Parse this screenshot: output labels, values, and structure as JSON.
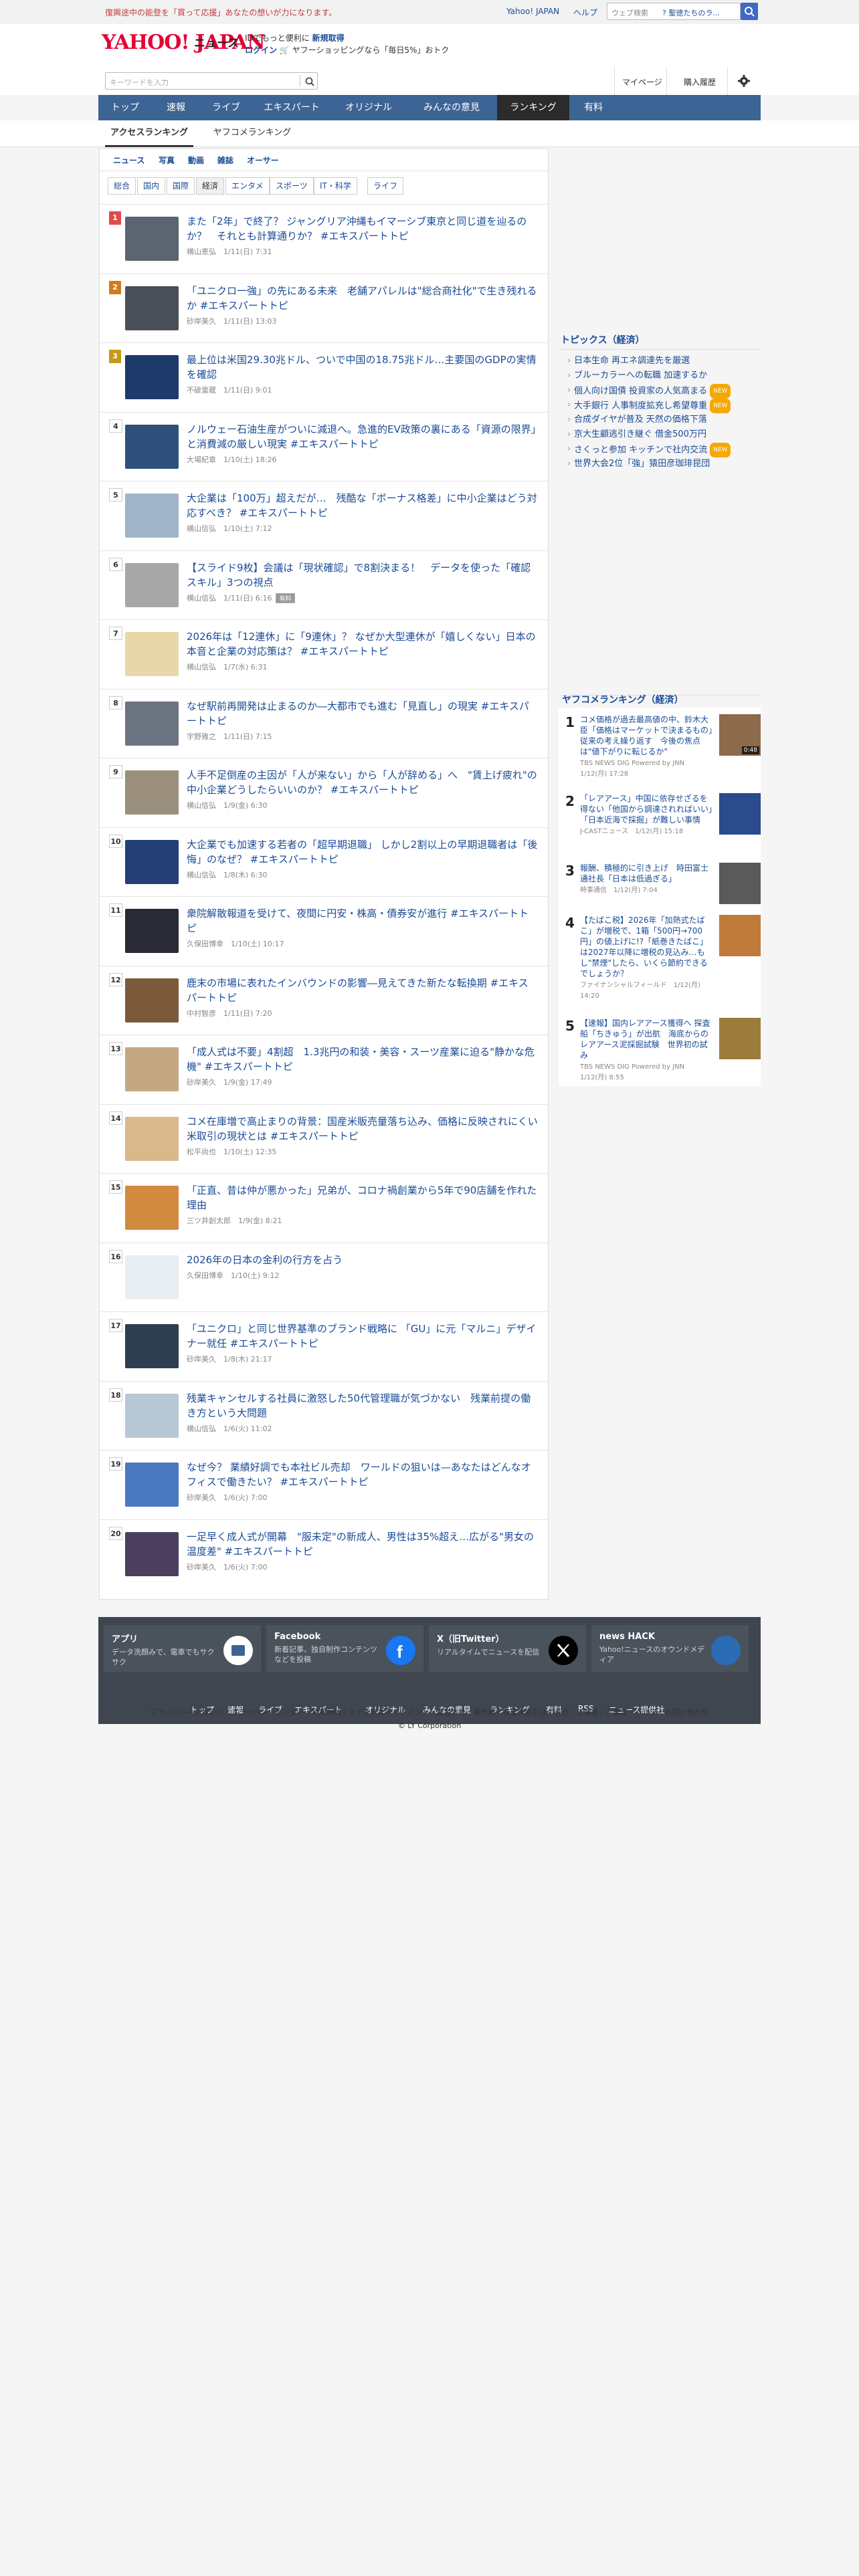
{
  "notice": {
    "text": "復興途中の能登を「買って応援」あなたの想いが力になります。",
    "links": [
      "Yahoo! JAPAN",
      "ヘルプ"
    ],
    "search_placeholder": "ウェブ検索",
    "prompt": "? 聖徳たちのラ..."
  },
  "brand": {
    "logo": "YAHOO! JAPAN",
    "name": "ニュース",
    "promo_line1": "IDでもっと便利に",
    "promo_link1": "新規取得",
    "promo_login": "ログイン",
    "promo_line2": "ヤフーショッピングなら「毎日5%」おトク"
  },
  "search": {
    "placeholder": "キーワードを入力",
    "mypage": "マイページ",
    "history": "購入履歴"
  },
  "nav": [
    "トップ",
    "速報",
    "ライブ",
    "エキスパート",
    "オリジナル",
    "みんなの意見",
    "ランキング",
    "有料"
  ],
  "tabs": [
    "アクセスランキング",
    "ヤフコメランキング"
  ],
  "categories": [
    "ニュース",
    "写真",
    "動画",
    "雑誌",
    "オーサー"
  ],
  "genres": [
    "総合",
    "国内",
    "国際",
    "経済",
    "エンタメ",
    "スポーツ",
    "IT・科学",
    "ライフ"
  ],
  "ranking": [
    {
      "rank": "1",
      "title": "また「2年」で終了？ ジャングリア沖縄もイマーシブ東京と同じ道を辿るのか？　それとも計算通りか？ #エキスパートトピ",
      "meta": "横山恵弘　1/11(日) 7:31"
    },
    {
      "rank": "2",
      "title": "「ユニクロ一強」の先にある未来　老舗アパレルは\"総合商社化\"で生き残れるか #エキスパートトピ",
      "meta": "砂岸美久　1/11(日) 13:03"
    },
    {
      "rank": "3",
      "title": "最上位は米国29.30兆ドル、ついで中国の18.75兆ドル…主要国のGDPの実情を確認",
      "meta": "不破雷蔵　1/11(日) 9:01"
    },
    {
      "rank": "4",
      "title": "ノルウェー石油生産がついに減退へ。急進的EV政策の裏にある「資源の限界」と消費減の厳しい現実 #エキスパートトピ",
      "meta": "大場紀章　1/10(土) 18:26"
    },
    {
      "rank": "5",
      "title": "大企業は「100万」超えだが…　残酷な「ボーナス格差」に中小企業はどう対応すべき？ #エキスパートトピ",
      "meta": "横山信弘　1/10(土) 7:12"
    },
    {
      "rank": "6",
      "title": "【スライド9枚】会議は「現状確認」で8割決まる！　データを使った「確認スキル」3つの視点",
      "meta": "横山信弘　1/11(日) 6:16",
      "tag": "有料"
    },
    {
      "rank": "7",
      "title": "2026年は「12連休」に「9連休」？ なぜか大型連休が「嬉しくない」日本の本音と企業の対応策は？ #エキスパートトピ",
      "meta": "横山信弘　1/7(水) 6:31"
    },
    {
      "rank": "8",
      "title": "なぜ駅前再開発は止まるのか―大都市でも進む「見直し」の現実 #エキスパートトピ",
      "meta": "宇野雅之　1/11(日) 7:15"
    },
    {
      "rank": "9",
      "title": "人手不足倒産の主因が「人が来ない」から「人が辞める」へ　\"賃上げ疲れ\"の中小企業どうしたらいいのか？ #エキスパートトピ",
      "meta": "横山信弘　1/9(金) 6:30"
    },
    {
      "rank": "10",
      "title": "大企業でも加速する若者の「超早期退職」 しかし2割以上の早期退職者は「後悔」のなぜ？ #エキスパートトピ",
      "meta": "横山信弘　1/8(木) 6:30"
    },
    {
      "rank": "11",
      "title": "衆院解散報道を受けて、夜間に円安・株高・債券安が進行 #エキスパートトピ",
      "meta": "久保田博幸　1/10(土) 10:17"
    },
    {
      "rank": "12",
      "title": "鹿末の市場に表れたインバウンドの影響―見えてきた新たな転換期 #エキスパートトピ",
      "meta": "中村智彦　1/11(日) 7:20"
    },
    {
      "rank": "13",
      "title": "「成人式は不要」4割超　1.3兆円の和装・美容・スーツ産業に迫る\"静かな危機\" #エキスパートトピ",
      "meta": "砂岸美久　1/9(金) 17:49"
    },
    {
      "rank": "14",
      "title": "コメ在庫増で高止まりの背景：国産米販売量落ち込み、価格に反映されにくい米取引の現状とは #エキスパートトピ",
      "meta": "松平尚也　1/10(土) 12:35"
    },
    {
      "rank": "15",
      "title": "「正直、昔は仲が悪かった」兄弟が、コロナ禍創業から5年で90店舗を作れた理由",
      "meta": "三ツ井創太郎　1/9(金) 8:21"
    },
    {
      "rank": "16",
      "title": "2026年の日本の金利の行方を占う",
      "meta": "久保田博幸　1/10(土) 9:12"
    },
    {
      "rank": "17",
      "title": "「ユニクロ」と同じ世界基準のブランド戦略に 「GU」に元「マルニ」デザイナー就任 #エキスパートトピ",
      "meta": "砂岸美久　1/8(木) 21:17"
    },
    {
      "rank": "18",
      "title": "残業キャンセルする社員に激怒した50代管理職が気づかない　残業前提の働き方という大問題",
      "meta": "横山信弘　1/6(火) 11:02"
    },
    {
      "rank": "19",
      "title": "なぜ今？ 業績好調でも本社ビル売却　ワールドの狙いは—あなたはどんなオフィスで働きたい？ #エキスパートトピ",
      "meta": "砂岸美久　1/6(火) 7:00"
    },
    {
      "rank": "20",
      "title": "一足早く成人式が開幕　\"服未定\"の新成人、男性は35%超え…広がる\"男女の温度差\" #エキスパートトピ",
      "meta": "砂岸美久　1/6(火) 7:00"
    }
  ],
  "topics": {
    "title": "トピックス（経済）",
    "items": [
      {
        "text": "日本生命 再エネ調達先を厳選",
        "new": false
      },
      {
        "text": "ブルーカラーへの転職 加速するか",
        "new": false
      },
      {
        "text": "個人向け国債 投資家の人気高まる",
        "new": true
      },
      {
        "text": "大手銀行 人事制度拡充し希望尊重",
        "new": true
      },
      {
        "text": "合成ダイヤが普及 天然の価格下落",
        "new": false
      },
      {
        "text": "京大生顧逃引き継ぐ 借金500万円",
        "new": false
      },
      {
        "text": "さくっと参加 キッチンで社内交流",
        "new": true
      },
      {
        "text": "世界大会2位「強」猿田彦珈琲昆団",
        "new": false
      }
    ]
  },
  "yahcom": {
    "title": "ヤフコメランキング（経済）",
    "items": [
      {
        "rank": "1",
        "text": "コメ価格が過去最高値の中、鈴木大臣「価格はマーケットで決まるもの」従来の考え繰り返す　今後の焦点は\"値下がりに転じるか\"",
        "meta": "TBS NEWS DIG Powered by JNN　1/12(月) 17:28",
        "badge": "0:48"
      },
      {
        "rank": "2",
        "text": "「レアアース」中国に依存せざるを得ない「他国から調達されればいい」「日本近海で採掘」が難しい事情",
        "meta": "J-CASTニュース　1/12(月) 15:18"
      },
      {
        "rank": "3",
        "text": "報酬、積極的に引き上げ　時田富士通社長「日本は低過ぎる」",
        "meta": "時事通信　1/12(月) 7:04"
      },
      {
        "rank": "4",
        "text": "【たばこ税】2026年「加熱式たばこ」が増税で、1箱「500円→700円」の値上げに!?「紙巻きたばこ」は2027年以降に増税の見込み…もし\"禁煙\"したら、いくら節約できるでしょうか？",
        "meta": "ファイナンシャルフィールド　1/12(月) 14:20"
      },
      {
        "rank": "5",
        "text": "【速報】国内レアアース獲得へ 探査船「ちきゅう」が出航　海底からのレアアース泥採掘試験　世界初の試み",
        "meta": "TBS NEWS DIG Powered by JNN　1/12(月) 8:55"
      }
    ]
  },
  "footer": {
    "boxes": [
      {
        "title": "アプリ",
        "desc": "データ洗顔みで、電車でもサクサク"
      },
      {
        "title": "Facebook",
        "desc": "新着記事、独自制作コンテンツなどを投稿"
      },
      {
        "title": "X（旧Twitter）",
        "desc": "リアルタイムでニュースを配信"
      },
      {
        "title": "news HACK",
        "desc": "Yahoo!ニュースのオウンドメディア"
      }
    ],
    "links": [
      "トップ",
      "速報",
      "ライブ",
      "エキスパート",
      "オリジナル",
      "みんなの意見",
      "ランキング",
      "有料",
      "RSS",
      "ニュース提供社"
    ],
    "legal": "プライバシーポリシー・プライバシーセンター・利用規約・メディアステートメント・運営方針・著作権・特定商取引法の表示・ご意見・ご要望・ヘルプ・お問い合わせ",
    "copyright": "© LY Corporation"
  },
  "colors": {
    "accent": "#3c6494",
    "link": "#1a4b96",
    "rank1": "#e04a4a",
    "rank2": "#d27a1f",
    "rank3": "#c59a1a"
  }
}
